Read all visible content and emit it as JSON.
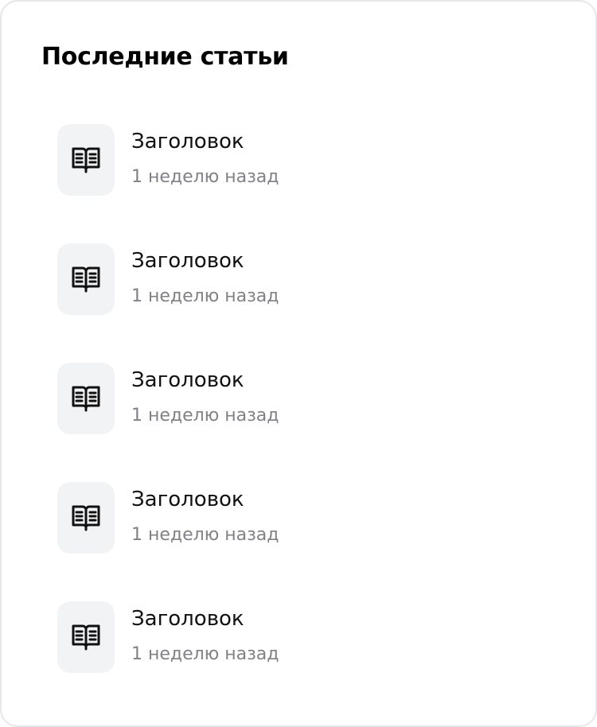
{
  "section": {
    "title": "Последние статьи"
  },
  "articles": [
    {
      "title": "Заголовок",
      "meta": "1 неделю назад",
      "icon": "open-book-icon"
    },
    {
      "title": "Заголовок",
      "meta": "1 неделю назад",
      "icon": "open-book-icon"
    },
    {
      "title": "Заголовок",
      "meta": "1 неделю назад",
      "icon": "open-book-icon"
    },
    {
      "title": "Заголовок",
      "meta": "1 неделю назад",
      "icon": "open-book-icon"
    },
    {
      "title": "Заголовок",
      "meta": "1 неделю назад",
      "icon": "open-book-icon"
    }
  ],
  "colors": {
    "title": "#000000",
    "item_title": "#111111",
    "meta": "#818187",
    "icon_bg": "#f2f3f5",
    "border": "#e6e7ea"
  }
}
